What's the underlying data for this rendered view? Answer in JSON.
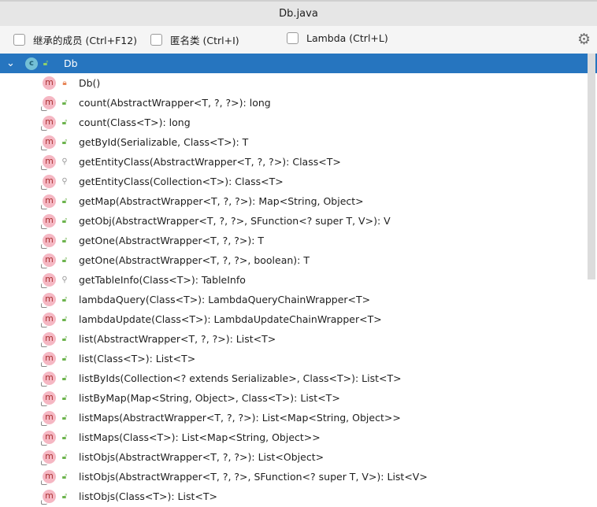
{
  "window_title": "Db.java",
  "filters": [
    {
      "label": "继承的成员 (Ctrl+F12)",
      "checked": false
    },
    {
      "label": "匿名类 (Ctrl+I)",
      "checked": false
    },
    {
      "label": "Lambda (Ctrl+L)",
      "checked": false
    }
  ],
  "settings_icon": "gear-icon",
  "root": {
    "label": "Db",
    "icon": "class-icon",
    "letter": "c"
  },
  "members": [
    {
      "label": "Db()",
      "access": "private",
      "overrides": false
    },
    {
      "label": "count(AbstractWrapper<T, ?, ?>): long",
      "access": "public",
      "overrides": true
    },
    {
      "label": "count(Class<T>): long",
      "access": "public",
      "overrides": true
    },
    {
      "label": "getById(Serializable, Class<T>): T",
      "access": "public",
      "overrides": true
    },
    {
      "label": "getEntityClass(AbstractWrapper<T, ?, ?>): Class<T>",
      "access": "protected",
      "overrides": true
    },
    {
      "label": "getEntityClass(Collection<T>): Class<T>",
      "access": "protected",
      "overrides": true
    },
    {
      "label": "getMap(AbstractWrapper<T, ?, ?>): Map<String, Object>",
      "access": "public",
      "overrides": true
    },
    {
      "label": "getObj(AbstractWrapper<T, ?, ?>, SFunction<? super T, V>): V",
      "access": "public",
      "overrides": true
    },
    {
      "label": "getOne(AbstractWrapper<T, ?, ?>): T",
      "access": "public",
      "overrides": true
    },
    {
      "label": "getOne(AbstractWrapper<T, ?, ?>, boolean): T",
      "access": "public",
      "overrides": true
    },
    {
      "label": "getTableInfo(Class<T>): TableInfo",
      "access": "protected",
      "overrides": true
    },
    {
      "label": "lambdaQuery(Class<T>): LambdaQueryChainWrapper<T>",
      "access": "public",
      "overrides": true
    },
    {
      "label": "lambdaUpdate(Class<T>): LambdaUpdateChainWrapper<T>",
      "access": "public",
      "overrides": true
    },
    {
      "label": "list(AbstractWrapper<T, ?, ?>): List<T>",
      "access": "public",
      "overrides": true
    },
    {
      "label": "list(Class<T>): List<T>",
      "access": "public",
      "overrides": true
    },
    {
      "label": "listByIds(Collection<? extends Serializable>, Class<T>): List<T>",
      "access": "public",
      "overrides": true
    },
    {
      "label": "listByMap(Map<String, Object>, Class<T>): List<T>",
      "access": "public",
      "overrides": true
    },
    {
      "label": "listMaps(AbstractWrapper<T, ?, ?>): List<Map<String, Object>>",
      "access": "public",
      "overrides": true
    },
    {
      "label": "listMaps(Class<T>): List<Map<String, Object>>",
      "access": "public",
      "overrides": true
    },
    {
      "label": "listObjs(AbstractWrapper<T, ?, ?>): List<Object>",
      "access": "public",
      "overrides": true
    },
    {
      "label": "listObjs(AbstractWrapper<T, ?, ?>, SFunction<? super T, V>): List<V>",
      "access": "public",
      "overrides": true
    },
    {
      "label": "listObjs(Class<T>): List<T>",
      "access": "public",
      "overrides": true
    }
  ]
}
